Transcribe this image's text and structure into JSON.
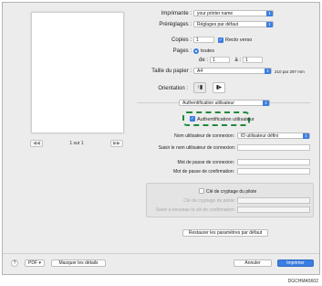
{
  "printer": {
    "label": "Imprimante :",
    "value": "your printer name"
  },
  "presets": {
    "label": "Préréglages :",
    "value": "Réglages par défaut"
  },
  "copies": {
    "label": "Copies :",
    "value": "1",
    "duplex_label": "Recto verso"
  },
  "pages": {
    "label": "Pages :",
    "all_label": "toutes",
    "from_label": "de :",
    "from_value": "1",
    "to_label": "à :",
    "to_value": "1"
  },
  "paper": {
    "label": "Taille du papier :",
    "value": "A4",
    "size_text": "210 par 297 mm"
  },
  "orientation": {
    "label": "Orientation :"
  },
  "panel": {
    "value": "Authentification utilisateur"
  },
  "auth": {
    "checkbox_label": "Authentification utilisateur"
  },
  "login_type": {
    "label": "Nom utilisateur de connexion:",
    "value": "ID utilisateur défini"
  },
  "login_name": {
    "label": "Saisir le nom utilisateur de connexion:"
  },
  "password": {
    "label": "Mot de passe de connexion:"
  },
  "password_confirm": {
    "label": "Mot de passe de confirmation:"
  },
  "driver_key": {
    "checkbox_label": "Clé de cryptage du pilote",
    "key_label": "Clé de cryptage du pilote:",
    "key_confirm_label": "Saisir à nouveau la clé de confirmation:"
  },
  "restore_label": "Restaurer les paramètres par défaut",
  "pager": {
    "text": "1 sur 1",
    "prev": "◀◀",
    "next": "▶▶"
  },
  "footer": {
    "help": "?",
    "pdf": "PDF",
    "show_details": "Masquer les détails",
    "cancel": "Annuler",
    "print": "Imprimer"
  },
  "doc_code": "DGCHMA5602"
}
